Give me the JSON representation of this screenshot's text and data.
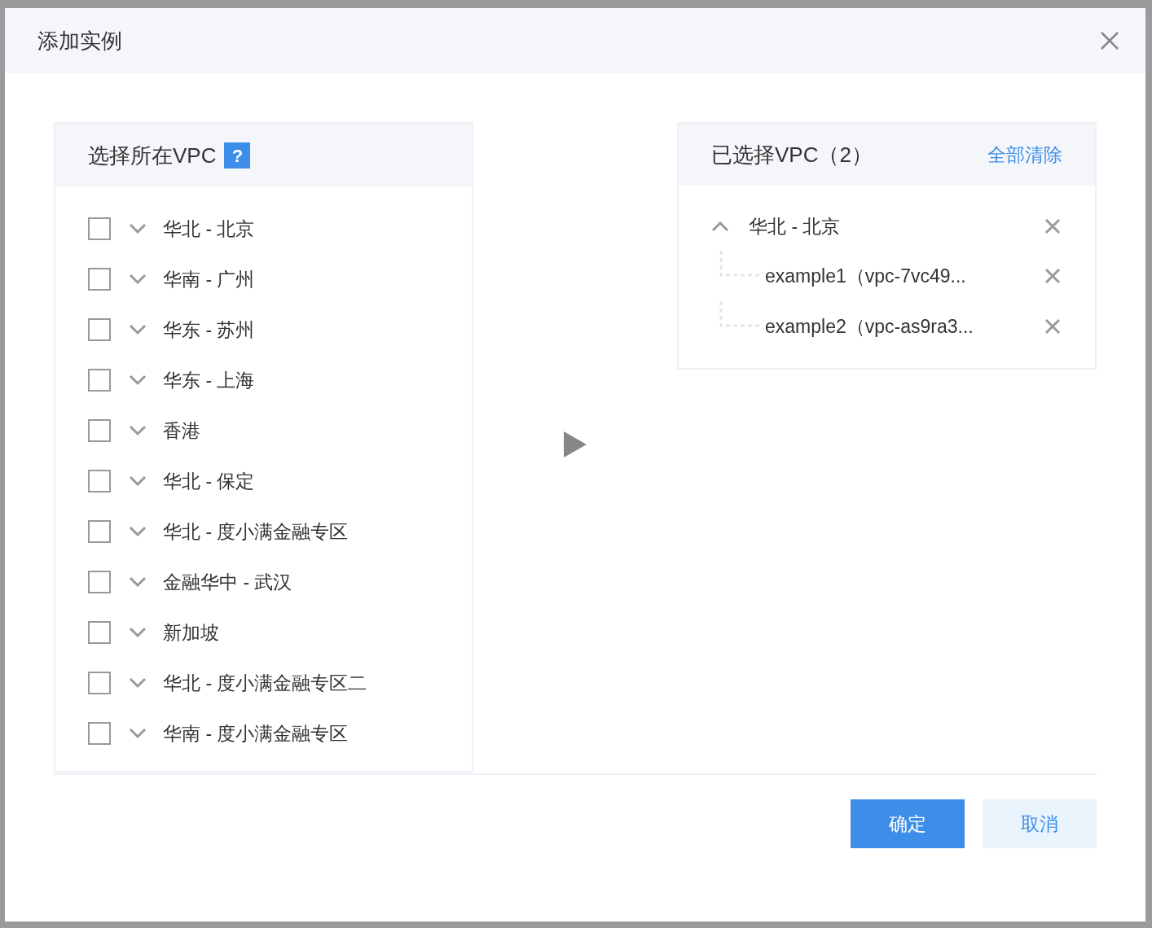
{
  "dialog": {
    "title": "添加实例"
  },
  "left_panel": {
    "title": "选择所在VPC",
    "help": "?",
    "regions": [
      {
        "label": "华北 - 北京",
        "checked": false,
        "expanded": false
      },
      {
        "label": "华南 - 广州",
        "checked": false,
        "expanded": false
      },
      {
        "label": "华东 - 苏州",
        "checked": false,
        "expanded": false
      },
      {
        "label": "华东 - 上海",
        "checked": false,
        "expanded": false
      },
      {
        "label": "香港",
        "checked": false,
        "expanded": false
      },
      {
        "label": "华北 - 保定",
        "checked": false,
        "expanded": false
      },
      {
        "label": "华北 - 度小满金融专区",
        "checked": false,
        "expanded": false
      },
      {
        "label": "金融华中 - 武汉",
        "checked": false,
        "expanded": false
      },
      {
        "label": "新加坡",
        "checked": false,
        "expanded": false
      },
      {
        "label": "华北 - 度小满金融专区二",
        "checked": false,
        "expanded": false
      },
      {
        "label": "华南 - 度小满金融专区",
        "checked": false,
        "expanded": false
      }
    ]
  },
  "right_panel": {
    "title": "已选择VPC（2）",
    "clear_all": "全部清除",
    "selected": [
      {
        "label": "华北 - 北京",
        "expanded": true,
        "children": [
          {
            "label": "example1（vpc-7vc49..."
          },
          {
            "label": "example2（vpc-as9ra3..."
          }
        ]
      }
    ]
  },
  "buttons": [
    {
      "label": "确定",
      "kind": "primary"
    },
    {
      "label": "取消",
      "kind": "secondary"
    }
  ]
}
